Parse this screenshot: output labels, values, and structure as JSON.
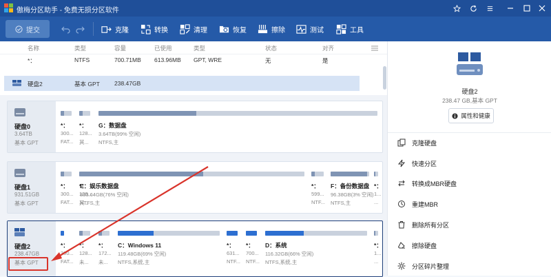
{
  "window": {
    "title": "傲梅分区助手 - 免费无损分区软件"
  },
  "toolbar": {
    "commit_label": "提交",
    "buttons": [
      {
        "label": "克隆",
        "icon": "clone-icon"
      },
      {
        "label": "转换",
        "icon": "convert-icon"
      },
      {
        "label": "清理",
        "icon": "cleanup-icon"
      },
      {
        "label": "恢复",
        "icon": "recover-icon"
      },
      {
        "label": "擦除",
        "icon": "wipe-icon"
      },
      {
        "label": "测试",
        "icon": "test-icon"
      },
      {
        "label": "工具",
        "icon": "tools-icon"
      }
    ]
  },
  "list": {
    "headers": {
      "name": "名称",
      "type": "类型",
      "capacity": "容量",
      "used": "已使用",
      "kind": "类型",
      "status": "状态",
      "aligned": "对齐"
    },
    "rows": [
      {
        "name": "*：",
        "type": "NTFS",
        "capacity": "700.71MB",
        "used": "613.96MB",
        "kind": "GPT, WRE",
        "status": "无",
        "aligned": "是"
      }
    ],
    "disk_row": {
      "name": "硬盘2",
      "type": "基本 GPT",
      "capacity": "238.47GB"
    }
  },
  "disks": [
    {
      "name": "硬盘0",
      "size": "3.64TB",
      "style": "基本 GPT",
      "partitions": [
        {
          "name": "*：",
          "info": "300...",
          "fs": "FAT...",
          "fill": 0.3
        },
        {
          "name": "*：",
          "info": "128...",
          "fs": "其...",
          "fill": 0.3
        },
        {
          "name": "G：数据盘",
          "info": "3.64TB(99% 空闲)",
          "fs": "NTFS,主",
          "fill": 0.35
        }
      ]
    },
    {
      "name": "硬盘1",
      "size": "931.51GB",
      "style": "基本 GPT",
      "partitions": [
        {
          "name": "*：",
          "info": "300...",
          "fs": "FAT...",
          "fill": 0.3
        },
        {
          "name": "*：",
          "info": "128...",
          "fs": "其...",
          "fill": 0.3
        },
        {
          "name": "E：娱乐数据盘",
          "info": "833.64GB(76% 空闲)",
          "fs": "NTFS,主",
          "fill": 0.55
        },
        {
          "name": "*：",
          "info": "599...",
          "fs": "NTF...",
          "fill": 0.3
        },
        {
          "name": "F：备份数据盘",
          "info": "96.38GB(3% 空闲)",
          "fs": "NTFS,主",
          "fill": 0.95
        },
        {
          "name": "*：",
          "info": "1...",
          "fs": "...",
          "fill": 0.3
        }
      ]
    },
    {
      "name": "硬盘2",
      "size": "238.47GB",
      "style": "基本 GPT",
      "partitions": [
        {
          "name": "*：",
          "info": "300...",
          "fs": "FAT...",
          "fill": 0.3
        },
        {
          "name": "*：",
          "info": "128...",
          "fs": "未...",
          "fill": 0.3
        },
        {
          "name": "*：",
          "info": "172...",
          "fs": "未...",
          "fill": 0.3
        },
        {
          "name": "C：Windows 11",
          "info": "119.48GB(69% 空闲)",
          "fs": "NTFS,系统,主",
          "fill": 0.35
        },
        {
          "name": "*：",
          "info": "631...",
          "fs": "NTF...",
          "fill": 0.3
        },
        {
          "name": "*：",
          "info": "700...",
          "fs": "NTF...",
          "fill": 0.3
        },
        {
          "name": "D：系统",
          "info": "116.32GB(66% 空闲)",
          "fs": "NTFS,系统,主",
          "fill": 0.38
        },
        {
          "name": "*：",
          "info": "1...",
          "fs": "...",
          "fill": 0.3
        }
      ]
    }
  ],
  "right_panel": {
    "disk_name": "硬盘2",
    "disk_meta": "238.47 GB,基本 GPT",
    "properties_label": "属性和健康",
    "actions": [
      {
        "label": "克隆硬盘",
        "icon": "clone-disk-icon"
      },
      {
        "label": "快速分区",
        "icon": "quick-partition-icon"
      },
      {
        "label": "转换成MBR硬盘",
        "icon": "convert-mbr-icon"
      },
      {
        "label": "重建MBR",
        "icon": "rebuild-mbr-icon"
      },
      {
        "label": "删除所有分区",
        "icon": "delete-partitions-icon"
      },
      {
        "label": "擦除硬盘",
        "icon": "wipe-disk-icon"
      },
      {
        "label": "分区碎片整理",
        "icon": "defrag-icon"
      }
    ]
  },
  "colors": {
    "titlebar": "#1f4f99",
    "toolbar": "#255aa8",
    "partition_used_blue": "#2d6fd1",
    "annotation_red": "#d9342b"
  }
}
